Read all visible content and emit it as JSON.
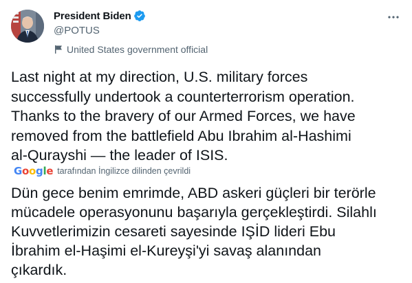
{
  "author": {
    "display_name": "President Biden",
    "handle": "@POTUS",
    "label": "United States government official",
    "verified": true
  },
  "icons": {
    "verified": "verified-badge-icon",
    "label": "flag-icon",
    "more": "more-options-icon"
  },
  "tweet": {
    "text": "Last night at my direction, U.S. military forces\nsuccessfully undertook a counterterrorism operation.\nThanks to the bravery of our Armed Forces, we have\nremoved from the battlefield Abu Ibrahim al-Hashimi\nal-Qurayshi — the leader of ISIS."
  },
  "translation": {
    "provider": "Google",
    "note": "tarafından İngilizce dilinden çevrildi",
    "text": "Dün gece benim emrimde, ABD askeri güçleri bir terörle\nmücadele operasyonunu başarıyla gerçekleştirdi. Silahlı\nKuvvetlerimizin cesareti sayesinde IŞİD lideri Ebu\nİbrahim el-Haşimi el-Kureyşi'yi savaş alanından\nçıkardık."
  },
  "colors": {
    "verified_blue": "#1d9bf0",
    "secondary_text": "#536471",
    "primary_text": "#0f1419"
  }
}
